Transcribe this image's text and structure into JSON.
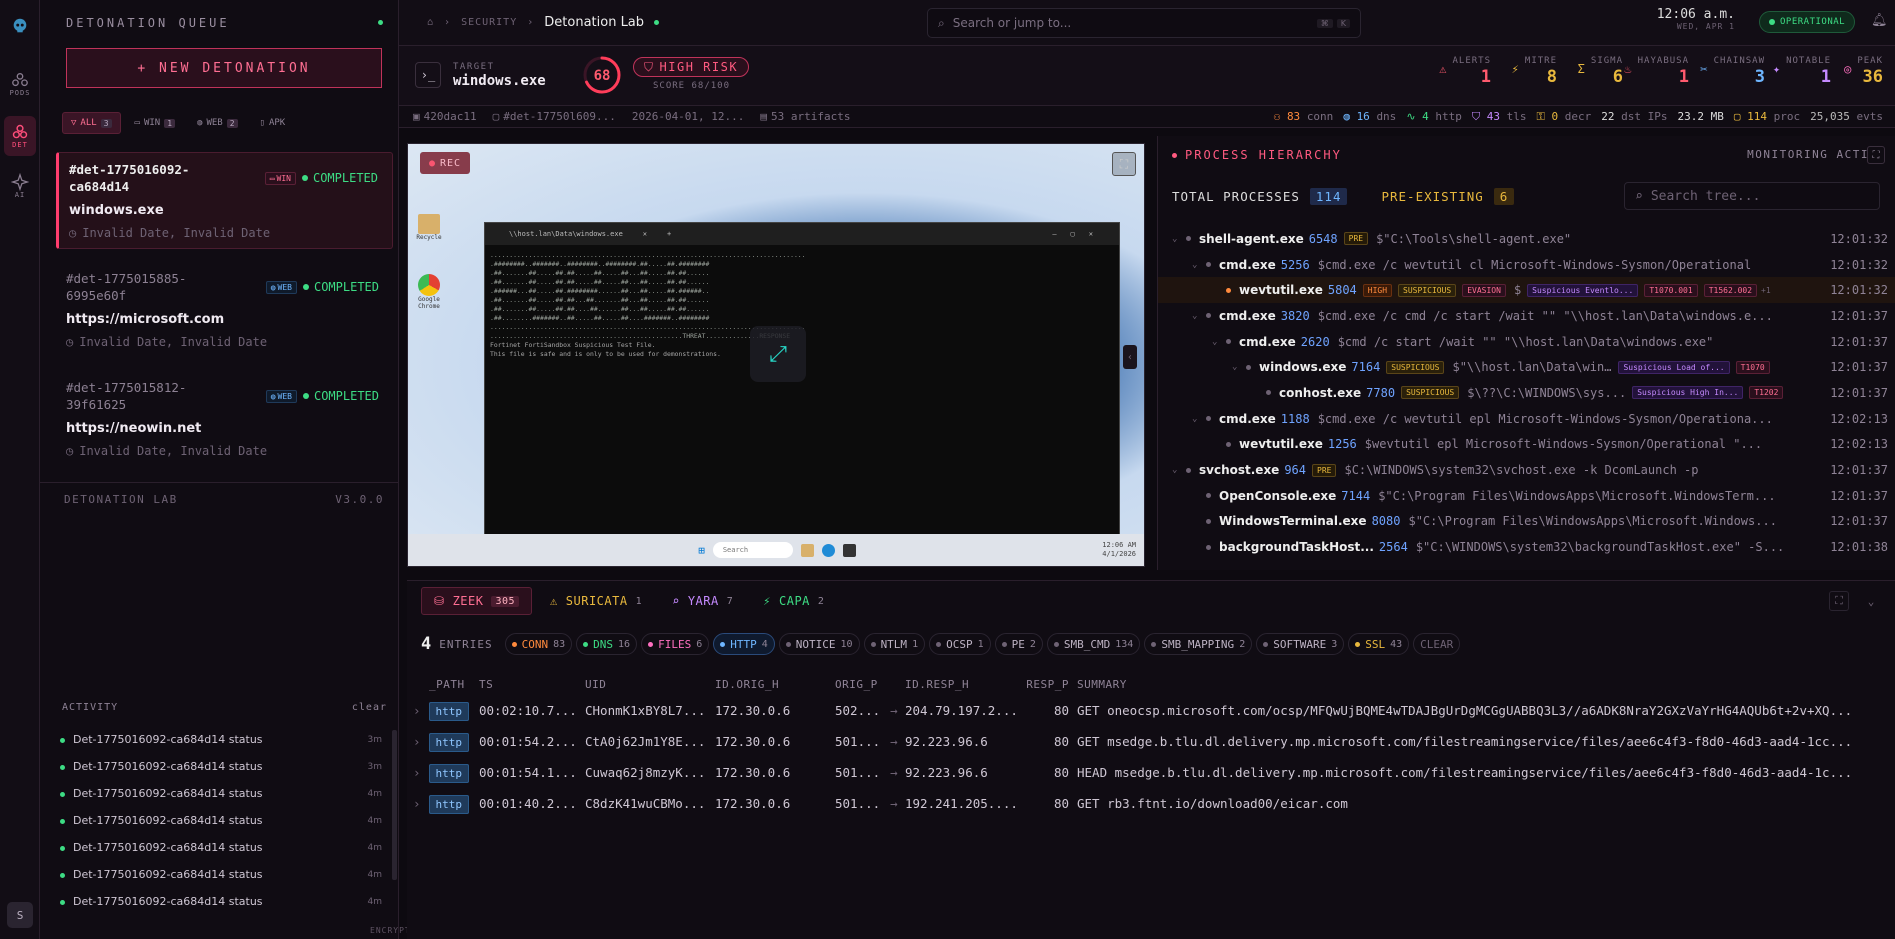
{
  "rail": {
    "items": [
      {
        "label": "PODS"
      },
      {
        "label": "DET"
      },
      {
        "label": "AI"
      }
    ],
    "avatar": "S"
  },
  "queue": {
    "title": "DETONATION QUEUE",
    "new_button": "+ NEW DETONATION",
    "filters": [
      {
        "label": "ALL",
        "count": "3"
      },
      {
        "label": "WIN",
        "count": "1"
      },
      {
        "label": "WEB",
        "count": "2"
      },
      {
        "label": "APK",
        "count": ""
      }
    ],
    "items": [
      {
        "id": "#det-1775016092-ca684d14",
        "platform": "WIN",
        "status": "COMPLETED",
        "name": "windows.exe",
        "date": "Invalid Date, Invalid Date"
      },
      {
        "id": "#det-1775015885-6995e60f",
        "platform": "WEB",
        "status": "COMPLETED",
        "name": "https://microsoft.com",
        "date": "Invalid Date, Invalid Date"
      },
      {
        "id": "#det-1775015812-39f61625",
        "platform": "WEB",
        "status": "COMPLETED",
        "name": "https://neowin.net",
        "date": "Invalid Date, Invalid Date"
      }
    ],
    "footer_name": "DETONATION LAB",
    "footer_version": "V3.0.0",
    "activity_title": "ACTIVITY",
    "activity_clear": "clear",
    "activity": [
      {
        "text": "Det-1775016092-ca684d14 status",
        "time": "3m"
      },
      {
        "text": "Det-1775016092-ca684d14 status",
        "time": "3m"
      },
      {
        "text": "Det-1775016092-ca684d14 status",
        "time": "4m"
      },
      {
        "text": "Det-1775016092-ca684d14 status",
        "time": "4m"
      },
      {
        "text": "Det-1775016092-ca684d14 status",
        "time": "4m"
      },
      {
        "text": "Det-1775016092-ca684d14 status",
        "time": "4m"
      },
      {
        "text": "Det-1775016092-ca684d14 status",
        "time": "4m"
      }
    ],
    "encrypted": "ENCRYPTED"
  },
  "top": {
    "crumb": "SECURITY",
    "title": "Detonation Lab",
    "search_placeholder": "Search or jump to...",
    "kbd1": "⌘",
    "kbd2": "K",
    "time": "12:06 a.m.",
    "date": "WED, APR 1",
    "status": "OPERATIONAL"
  },
  "target": {
    "label": "TARGET",
    "name": "windows.exe",
    "score": 68,
    "risk": "HIGH RISK",
    "score_text": "SCORE 68/100",
    "stats": [
      {
        "label": "ALERTS",
        "value": "1",
        "color": "#ff5a6e",
        "icon": "warning-icon"
      },
      {
        "label": "MITRE",
        "value": "8",
        "color": "#e8b83d",
        "icon": "bolt-icon"
      },
      {
        "label": "SIGMA",
        "value": "6",
        "color": "#e8b83d",
        "icon": "sigma-icon"
      },
      {
        "label": "HAYABUSA",
        "value": "1",
        "color": "#ff5a6e",
        "icon": "flame-icon"
      },
      {
        "label": "CHAINSAW",
        "value": "3",
        "color": "#6fb6ff",
        "icon": "chain-icon"
      },
      {
        "label": "NOTABLE",
        "value": "1",
        "color": "#c58aff",
        "icon": "star-icon"
      },
      {
        "label": "PEAK",
        "value": "36",
        "color": "#e8b83d",
        "icon": "peak-icon"
      }
    ]
  },
  "meta": {
    "hash": "420dac11",
    "det": "#det-17750l609...",
    "date": "2026-04-01, 12...",
    "artifacts": "53 artifacts",
    "conn": "83",
    "conn_l": "conn",
    "dns": "16",
    "dns_l": "dns",
    "http": "4",
    "http_l": "http",
    "tls": "43",
    "tls_l": "tls",
    "decr": "0",
    "decr_l": "decr",
    "dstips": "22",
    "dstips_l": "dst IPs",
    "size": "23.2 MB",
    "proc": "114",
    "proc_l": "proc",
    "evts": "25,035",
    "evts_l": "evts"
  },
  "vm": {
    "rec": "REC",
    "term_title": "\\\\host.lan\\Data\\windows.exe",
    "ascii": "..................................................................................\n.########..#######..########..########.##.....##.########\n.##.......##.....##.##.....##.....##...##.....##.##......\n.##.......##.....##.##.....##.....##...##.....##.##......\n.######...##.....##.########......##...##.....##.######..\n.##.......##.....##.##...##.......##...##.....##.##......\n.##.......##.....##.##....##......##...##.....##.##......\n.##........#######..##.....##.....##....#######..########\n..................................................................................\n..................................................THREAT..............RESPONSE\n",
    "line1": "Fortinet FortiSandbox Suspicious Test File.",
    "line2": "This file is safe and is only to be used for demonstrations.",
    "taskbar_search": "Search",
    "tray_time": "12:06 AM",
    "tray_date": "4/1/2026"
  },
  "proc": {
    "title": "PROCESS HIERARCHY",
    "monitoring": "MONITORING ACTI",
    "total_label": "TOTAL PROCESSES",
    "total": "114",
    "pre_label": "PRE-EXISTING",
    "pre": "6",
    "search_placeholder": "Search tree...",
    "rows": [
      {
        "depth": 0,
        "name": "shell-agent.exe",
        "pid": "6548",
        "badges": [
          "PRE"
        ],
        "cmd": "$\"C:\\Tools\\shell-agent.exe\"",
        "time": "12:01:32"
      },
      {
        "depth": 1,
        "name": "cmd.exe",
        "pid": "5256",
        "badges": [],
        "cmd": "$cmd.exe /c wevtutil cl Microsoft-Windows-Sysmon/Operational",
        "time": "12:01:32"
      },
      {
        "depth": 2,
        "name": "wevtutil.exe",
        "pid": "5804",
        "badges": [
          "HIGH",
          "SUSPICIOUS",
          "EVASION"
        ],
        "cmd": "$",
        "sig": "Suspicious Eventlo...",
        "t": [
          "T1070.001",
          "T1562.002"
        ],
        "more": "+1",
        "time": "12:01:32",
        "hl": true
      },
      {
        "depth": 1,
        "name": "cmd.exe",
        "pid": "3820",
        "badges": [],
        "cmd": "$cmd.exe /c cmd /c start /wait \"\" \"\\\\host.lan\\Data\\windows.e...",
        "time": "12:01:37"
      },
      {
        "depth": 2,
        "name": "cmd.exe",
        "pid": "2620",
        "badges": [],
        "cmd": "$cmd /c start /wait \"\" \"\\\\host.lan\\Data\\windows.exe\"",
        "time": "12:01:37"
      },
      {
        "depth": 3,
        "name": "windows.exe",
        "pid": "7164",
        "badges": [
          "SUSPICIOUS"
        ],
        "cmd": "$\"\\\\host.lan\\Data\\win...",
        "sig": "Suspicious Load of...",
        "t": [
          "T1070"
        ],
        "time": "12:01:37"
      },
      {
        "depth": 4,
        "name": "conhost.exe",
        "pid": "7780",
        "badges": [
          "SUSPICIOUS"
        ],
        "cmd": "$\\??\\C:\\WINDOWS\\sys...",
        "sig": "Suspicious High In...",
        "t": [
          "T1202"
        ],
        "time": "12:01:37"
      },
      {
        "depth": 1,
        "name": "cmd.exe",
        "pid": "1188",
        "badges": [],
        "cmd": "$cmd.exe /c wevtutil epl Microsoft-Windows-Sysmon/Operationa...",
        "time": "12:02:13"
      },
      {
        "depth": 2,
        "name": "wevtutil.exe",
        "pid": "1256",
        "badges": [],
        "cmd": "$wevtutil epl Microsoft-Windows-Sysmon/Operational \"...",
        "time": "12:02:13"
      },
      {
        "depth": 0,
        "name": "svchost.exe",
        "pid": "964",
        "badges": [
          "PRE"
        ],
        "cmd": "$C:\\WINDOWS\\system32\\svchost.exe -k DcomLaunch -p",
        "time": "12:01:37"
      },
      {
        "depth": 1,
        "name": "OpenConsole.exe",
        "pid": "7144",
        "badges": [],
        "cmd": "$\"C:\\Program Files\\WindowsApps\\Microsoft.WindowsTerm...",
        "time": "12:01:37"
      },
      {
        "depth": 1,
        "name": "WindowsTerminal.exe",
        "pid": "8080",
        "badges": [],
        "cmd": "$\"C:\\Program Files\\WindowsApps\\Microsoft.Windows...",
        "time": "12:01:37"
      },
      {
        "depth": 1,
        "name": "backgroundTaskHost...",
        "pid": "2564",
        "badges": [],
        "cmd": "$\"C:\\WINDOWS\\system32\\backgroundTaskHost.exe\" -S...",
        "time": "12:01:38"
      }
    ]
  },
  "bottom": {
    "tabs": [
      {
        "label": "ZEEK",
        "count": "305"
      },
      {
        "label": "SURICATA",
        "count": "1"
      },
      {
        "label": "YARA",
        "count": "7"
      },
      {
        "label": "CAPA",
        "count": "2"
      }
    ],
    "entries": "4",
    "entries_label": "ENTRIES",
    "chips": [
      {
        "label": "CONN",
        "count": "83",
        "cls": "conn"
      },
      {
        "label": "DNS",
        "count": "16",
        "cls": "dns"
      },
      {
        "label": "FILES",
        "count": "6",
        "cls": "files"
      },
      {
        "label": "HTTP",
        "count": "4",
        "cls": "http"
      },
      {
        "label": "NOTICE",
        "count": "10",
        "cls": ""
      },
      {
        "label": "NTLM",
        "count": "1",
        "cls": ""
      },
      {
        "label": "OCSP",
        "count": "1",
        "cls": ""
      },
      {
        "label": "PE",
        "count": "2",
        "cls": ""
      },
      {
        "label": "SMB_CMD",
        "count": "134",
        "cls": ""
      },
      {
        "label": "SMB_MAPPING",
        "count": "2",
        "cls": ""
      },
      {
        "label": "SOFTWARE",
        "count": "3",
        "cls": ""
      },
      {
        "label": "SSL",
        "count": "43",
        "cls": "ssl"
      },
      {
        "label": "CLEAR",
        "count": "",
        "cls": "clear"
      }
    ],
    "columns": [
      "_PATH",
      "TS",
      "UID",
      "ID.ORIG_H",
      "ORIG_P",
      "ID.RESP_H",
      "RESP_P",
      "SUMMARY"
    ],
    "rows": [
      {
        "path": "http",
        "ts": "00:02:10.7...",
        "uid": "CHonmK1xBY8L7...",
        "orig_h": "172.30.0.6",
        "orig_p": "502...",
        "resp_h": "204.79.197.2...",
        "resp_p": "80",
        "summary": "GET oneocsp.microsoft.com/ocsp/MFQwUjBQME4wTDAJBgUrDgMCGgUABBQ3L3//a6ADK8NraY2GXzVaYrHG4AQUb6t+2v+XQ..."
      },
      {
        "path": "http",
        "ts": "00:01:54.2...",
        "uid": "CtA0j62Jm1Y8E...",
        "orig_h": "172.30.0.6",
        "orig_p": "501...",
        "resp_h": "92.223.96.6",
        "resp_p": "80",
        "summary": "GET msedge.b.tlu.dl.delivery.mp.microsoft.com/filestreamingservice/files/aee6c4f3-f8d0-46d3-aad4-1cc..."
      },
      {
        "path": "http",
        "ts": "00:01:54.1...",
        "uid": "Cuwaq62j8mzyK...",
        "orig_h": "172.30.0.6",
        "orig_p": "501...",
        "resp_h": "92.223.96.6",
        "resp_p": "80",
        "summary": "HEAD msedge.b.tlu.dl.delivery.mp.microsoft.com/filestreamingservice/files/aee6c4f3-f8d0-46d3-aad4-1c..."
      },
      {
        "path": "http",
        "ts": "00:01:40.2...",
        "uid": "C8dzK41wuCBMo...",
        "orig_h": "172.30.0.6",
        "orig_p": "501...",
        "resp_h": "192.241.205....",
        "resp_p": "80",
        "summary": "GET rb3.ftnt.io/download00/eicar.com"
      }
    ]
  }
}
